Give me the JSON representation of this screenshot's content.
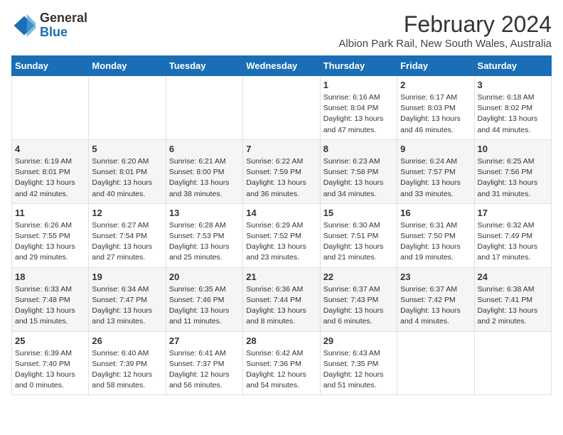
{
  "logo": {
    "general": "General",
    "blue": "Blue"
  },
  "header": {
    "title": "February 2024",
    "subtitle": "Albion Park Rail, New South Wales, Australia"
  },
  "weekdays": [
    "Sunday",
    "Monday",
    "Tuesday",
    "Wednesday",
    "Thursday",
    "Friday",
    "Saturday"
  ],
  "weeks": [
    [
      {
        "day": "",
        "info": ""
      },
      {
        "day": "",
        "info": ""
      },
      {
        "day": "",
        "info": ""
      },
      {
        "day": "",
        "info": ""
      },
      {
        "day": "1",
        "info": "Sunrise: 6:16 AM\nSunset: 8:04 PM\nDaylight: 13 hours and 47 minutes."
      },
      {
        "day": "2",
        "info": "Sunrise: 6:17 AM\nSunset: 8:03 PM\nDaylight: 13 hours and 46 minutes."
      },
      {
        "day": "3",
        "info": "Sunrise: 6:18 AM\nSunset: 8:02 PM\nDaylight: 13 hours and 44 minutes."
      }
    ],
    [
      {
        "day": "4",
        "info": "Sunrise: 6:19 AM\nSunset: 8:01 PM\nDaylight: 13 hours and 42 minutes."
      },
      {
        "day": "5",
        "info": "Sunrise: 6:20 AM\nSunset: 8:01 PM\nDaylight: 13 hours and 40 minutes."
      },
      {
        "day": "6",
        "info": "Sunrise: 6:21 AM\nSunset: 8:00 PM\nDaylight: 13 hours and 38 minutes."
      },
      {
        "day": "7",
        "info": "Sunrise: 6:22 AM\nSunset: 7:59 PM\nDaylight: 13 hours and 36 minutes."
      },
      {
        "day": "8",
        "info": "Sunrise: 6:23 AM\nSunset: 7:58 PM\nDaylight: 13 hours and 34 minutes."
      },
      {
        "day": "9",
        "info": "Sunrise: 6:24 AM\nSunset: 7:57 PM\nDaylight: 13 hours and 33 minutes."
      },
      {
        "day": "10",
        "info": "Sunrise: 6:25 AM\nSunset: 7:56 PM\nDaylight: 13 hours and 31 minutes."
      }
    ],
    [
      {
        "day": "11",
        "info": "Sunrise: 6:26 AM\nSunset: 7:55 PM\nDaylight: 13 hours and 29 minutes."
      },
      {
        "day": "12",
        "info": "Sunrise: 6:27 AM\nSunset: 7:54 PM\nDaylight: 13 hours and 27 minutes."
      },
      {
        "day": "13",
        "info": "Sunrise: 6:28 AM\nSunset: 7:53 PM\nDaylight: 13 hours and 25 minutes."
      },
      {
        "day": "14",
        "info": "Sunrise: 6:29 AM\nSunset: 7:52 PM\nDaylight: 13 hours and 23 minutes."
      },
      {
        "day": "15",
        "info": "Sunrise: 6:30 AM\nSunset: 7:51 PM\nDaylight: 13 hours and 21 minutes."
      },
      {
        "day": "16",
        "info": "Sunrise: 6:31 AM\nSunset: 7:50 PM\nDaylight: 13 hours and 19 minutes."
      },
      {
        "day": "17",
        "info": "Sunrise: 6:32 AM\nSunset: 7:49 PM\nDaylight: 13 hours and 17 minutes."
      }
    ],
    [
      {
        "day": "18",
        "info": "Sunrise: 6:33 AM\nSunset: 7:48 PM\nDaylight: 13 hours and 15 minutes."
      },
      {
        "day": "19",
        "info": "Sunrise: 6:34 AM\nSunset: 7:47 PM\nDaylight: 13 hours and 13 minutes."
      },
      {
        "day": "20",
        "info": "Sunrise: 6:35 AM\nSunset: 7:46 PM\nDaylight: 13 hours and 11 minutes."
      },
      {
        "day": "21",
        "info": "Sunrise: 6:36 AM\nSunset: 7:44 PM\nDaylight: 13 hours and 8 minutes."
      },
      {
        "day": "22",
        "info": "Sunrise: 6:37 AM\nSunset: 7:43 PM\nDaylight: 13 hours and 6 minutes."
      },
      {
        "day": "23",
        "info": "Sunrise: 6:37 AM\nSunset: 7:42 PM\nDaylight: 13 hours and 4 minutes."
      },
      {
        "day": "24",
        "info": "Sunrise: 6:38 AM\nSunset: 7:41 PM\nDaylight: 13 hours and 2 minutes."
      }
    ],
    [
      {
        "day": "25",
        "info": "Sunrise: 6:39 AM\nSunset: 7:40 PM\nDaylight: 13 hours and 0 minutes."
      },
      {
        "day": "26",
        "info": "Sunrise: 6:40 AM\nSunset: 7:39 PM\nDaylight: 12 hours and 58 minutes."
      },
      {
        "day": "27",
        "info": "Sunrise: 6:41 AM\nSunset: 7:37 PM\nDaylight: 12 hours and 56 minutes."
      },
      {
        "day": "28",
        "info": "Sunrise: 6:42 AM\nSunset: 7:36 PM\nDaylight: 12 hours and 54 minutes."
      },
      {
        "day": "29",
        "info": "Sunrise: 6:43 AM\nSunset: 7:35 PM\nDaylight: 12 hours and 51 minutes."
      },
      {
        "day": "",
        "info": ""
      },
      {
        "day": "",
        "info": ""
      }
    ]
  ]
}
